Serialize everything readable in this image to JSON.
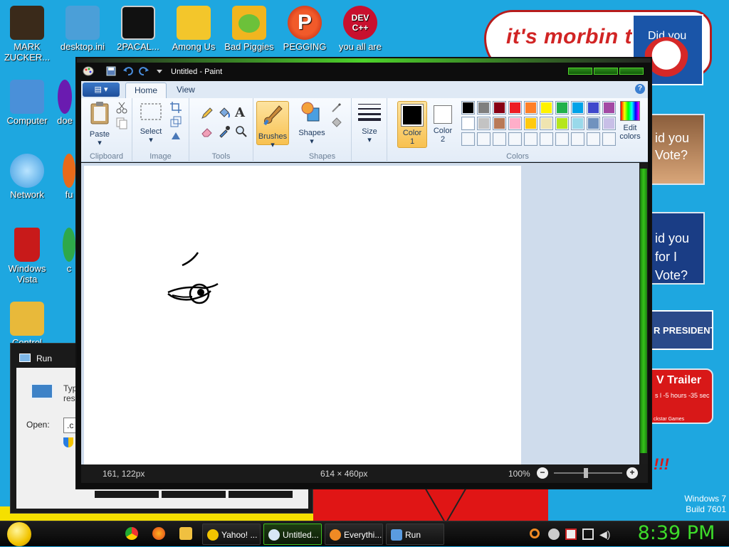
{
  "desktop": {
    "icons": [
      {
        "label": "MARK ZUCKER...",
        "color": "#3a2a1a"
      },
      {
        "label": "desktop.ini",
        "color": "#4b9fd8"
      },
      {
        "label": "2PACAL...",
        "color": "#111111"
      },
      {
        "label": "Among Us",
        "color": "#f3c62b"
      },
      {
        "label": "Bad Piggies",
        "color": "#f1b51f"
      },
      {
        "label": "PEGGING",
        "color": "#e23a2a"
      },
      {
        "label": "you all are",
        "color": "#c8102e"
      },
      {
        "label": "Computer",
        "color": "#4a90d9"
      },
      {
        "label": "doe",
        "color": "#6a1bb0"
      },
      {
        "label": "Network",
        "color": "#3b9be0"
      },
      {
        "label": "fu",
        "color": "#e86a1a"
      },
      {
        "label": "Windows Vista",
        "color": "#c81a1a"
      },
      {
        "label": "c",
        "color": "#2ea84a"
      },
      {
        "label": "Control",
        "color": "#e8b93a"
      }
    ],
    "dev_icon_text": "DEV C++",
    "poster_morbin": "it's morbin t",
    "poster1_text": "Did you",
    "poster2_text": "id you Vote?",
    "poster3_text": "id you for I Vote?",
    "poster4_text": "R PRESIDENT",
    "poster5_title": "V Trailer",
    "poster5_sub": "s l -5 hours -35 sec",
    "poster5_brand": "ckstar Games",
    "exclaim": "!!!",
    "watermark_line1": "Windows 7",
    "watermark_line2": "Build 7601"
  },
  "run_dialog": {
    "title": "Run",
    "desc_line1": "Typ",
    "desc_line2": "reso",
    "open_label": "Open:",
    "open_value": ".c"
  },
  "paint": {
    "window_title": "Untitled - Paint",
    "tabs": [
      "Home",
      "View"
    ],
    "help": "?",
    "clipboard": {
      "paste": "Paste",
      "group": "Clipboard"
    },
    "image": {
      "select": "Select",
      "group": "Image"
    },
    "tools": {
      "text_tool": "A",
      "group": "Tools"
    },
    "brushes": {
      "label": "Brushes"
    },
    "shapes": {
      "label": "Shapes",
      "group": "Shapes"
    },
    "size": {
      "label": "Size"
    },
    "color1": {
      "label_line1": "Color",
      "label_line2": "1"
    },
    "color2": {
      "label_line1": "Color",
      "label_line2": "2"
    },
    "edit_colors": {
      "line1": "Edit",
      "line2": "colors"
    },
    "colors_group": "Colors",
    "palette_row1": [
      "#000000",
      "#7f7f7f",
      "#880015",
      "#ed1c24",
      "#ff7f27",
      "#fff200",
      "#22b14c",
      "#00a2e8",
      "#3f48cc",
      "#a349a4"
    ],
    "palette_row2": [
      "#ffffff",
      "#c3c3c3",
      "#b97a57",
      "#ffaec9",
      "#ffc90e",
      "#efe4b0",
      "#b5e61d",
      "#99d9ea",
      "#7092be",
      "#c8bfe7"
    ],
    "status": {
      "cursor_pos": "161, 122px",
      "canvas_size": "614 × 460px",
      "zoom": "100%"
    }
  },
  "taskbar": {
    "buttons": [
      {
        "label": "Yahoo! ...",
        "icon_color": "#f2c400"
      },
      {
        "label": "Untitled...",
        "icon_color": "#d8e6f5"
      },
      {
        "label": "Everythi...",
        "icon_color": "#f08a24"
      },
      {
        "label": "Run",
        "icon_color": "#5a9be0"
      }
    ],
    "clock": "8:39 PM"
  }
}
